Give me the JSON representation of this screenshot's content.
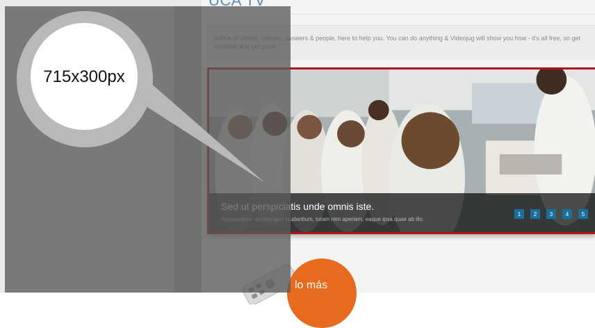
{
  "site": {
    "title": "UCA TV",
    "intro": "1000s of videos, articles, answers & people, here to help you. You can do anything & Videojug will show you how - it's all free, so get involved and get good"
  },
  "slider": {
    "caption_title": "Sed ut perspiciatis unde omnis iste.",
    "caption_subtitle": "Accusantium doloremque laudantium, totam rem aperiam, eaque ipsa quae ab illo.",
    "pages": [
      "1",
      "2",
      "3",
      "4",
      "5"
    ],
    "border_color": "#b31217",
    "pager_color": "#1a6f9b"
  },
  "promo": {
    "label": "lo más",
    "color": "#e86a1d"
  },
  "annotation": {
    "size_label": "715x300px"
  },
  "icons": {
    "remote": "tv-remote-icon"
  }
}
